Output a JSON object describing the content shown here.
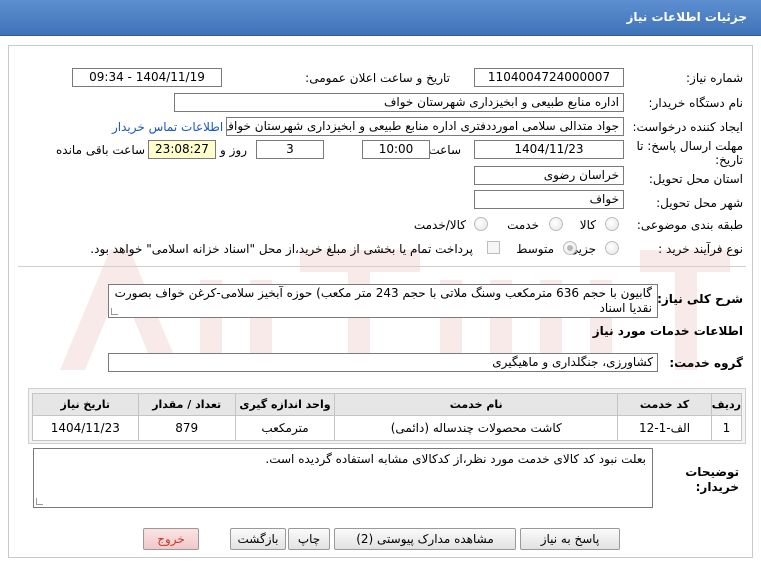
{
  "window": {
    "title": "جزئیات اطلاعات نیاز"
  },
  "form": {
    "need_number_label": "شماره نیاز:",
    "need_number": "1104004724000007",
    "announce_label": "تاریخ و ساعت اعلان عمومی:",
    "announce_value": "1404/11/19 - 09:34",
    "buyer_label": "نام دستگاه خریدار:",
    "buyer_value": "اداره منابع طبیعی و ابخیزداری شهرستان خواف",
    "creator_label": "ایجاد کننده درخواست:",
    "creator_value": "جواد متدالی سلامی امورددفتری اداره منابع طبیعی و ابخیزداری شهرستان خواف",
    "contact_link": "اطلاعات تماس خریدار",
    "deadline_label_1": "مهلت ارسال پاسخ: تا",
    "deadline_label_2": "تاریخ:",
    "deadline_date": "1404/11/23",
    "time_label": "ساعت",
    "deadline_time": "10:00",
    "days_value": "3",
    "days_label": "روز و",
    "remaining_time": "23:08:27",
    "remaining_label": "ساعت باقی مانده",
    "province_label": "استان محل تحویل:",
    "province_value": "خراسان رضوی",
    "city_label": "شهر محل تحویل:",
    "city_value": "خواف",
    "category_label": "طبقه بندی موضوعی:",
    "category_options": [
      "کالا",
      "خدمت",
      "کالا/خدمت"
    ],
    "process_label": "نوع فرآیند خرید :",
    "process_options": [
      "جزیی",
      "متوسط"
    ],
    "payment_note": "پرداخت تمام یا بخشی از مبلغ خرید،از محل \"اسناد خزانه اسلامی\" خواهد بود."
  },
  "description": {
    "label": "شرح کلی نیاز:",
    "text_line1": "گابیون با حجم 636 مترمکعب وسنگ ملاتی با حجم 243 متر مکعب) حوزه آبخیز سلامی-کرغن خواف بصورت",
    "text_line2": "نقدیا اسناد"
  },
  "services": {
    "section_title": "اطلاعات خدمات مورد نیاز",
    "group_label": "گروه خدمت:",
    "group_value": "کشاورزی، جنگلداری و ماهیگیری",
    "columns": [
      "ردیف",
      "کد خدمت",
      "نام خدمت",
      "واحد اندازه گیری",
      "تعداد / مقدار",
      "تاریخ نیاز"
    ],
    "rows": [
      {
        "row": "1",
        "code": "الف-1-12",
        "name": "کاشت محصولات چندساله (دائمی)",
        "unit": "مترمکعب",
        "qty": "879",
        "date": "1404/11/23"
      }
    ]
  },
  "buyer_notes": {
    "label_1": "توضیحات",
    "label_2": "خریدار:",
    "text": "بعلت نبود کد کالای خدمت مورد نظر،از کدکالای مشابه استفاده گردیده است."
  },
  "buttons": {
    "reply": "پاسخ به نیاز",
    "attachments": "مشاهده مدارک پیوستی (2)",
    "print": "چاپ",
    "back": "بازگشت",
    "exit": "خروج"
  },
  "colors": {
    "title_bar": "#4a7fc4",
    "link": "#1a56c4",
    "exit_text": "#c0392b"
  }
}
